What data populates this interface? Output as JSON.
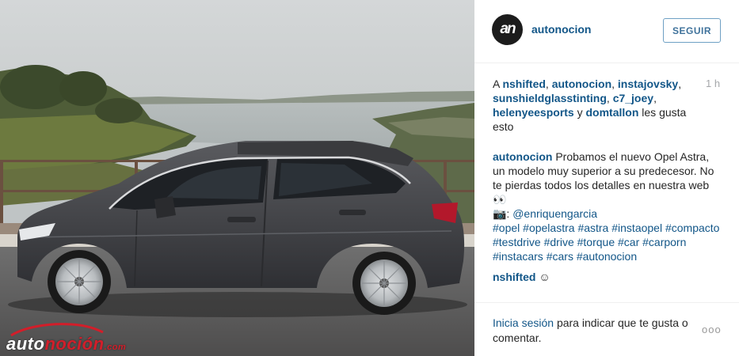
{
  "post": {
    "username": "autonocion",
    "follow_label": "SEGUIR",
    "time": "1 h",
    "likes": {
      "prefix": "A",
      "users": [
        "nshifted",
        "autonocion",
        "instajovsky",
        "sunshieldglasstinting",
        "c7_joey",
        "helenyeesports",
        "domtallon"
      ],
      "conjunction": "y",
      "suffix": "les gusta esto"
    },
    "caption": {
      "user": "autonocion",
      "text": "Probamos el nuevo Opel Astra, un modelo muy superior a su predecesor. No te pierdas todos los detalles en nuestra web 👀",
      "credit_prefix": "📷: ",
      "credit_handle": "@enriquengarcia",
      "hashtags": [
        "#opel",
        "#opelastra",
        "#astra",
        "#instaopel",
        "#compacto",
        "#testdrive",
        "#drive",
        "#torque",
        "#car",
        "#carporn",
        "#instacars",
        "#cars",
        "#autonocion"
      ]
    },
    "comment": {
      "user": "nshifted",
      "emoji": "☺"
    },
    "footer": {
      "login_link": "Inicia sesión",
      "login_text": "para indicar que te gusta o comentar.",
      "more_icon": "ellipsis-icon",
      "more_label": "ooo"
    },
    "avatar": {
      "letters": "an"
    },
    "watermark": {
      "part1": "auto",
      "part2": "noción",
      "part3": ".com"
    }
  }
}
